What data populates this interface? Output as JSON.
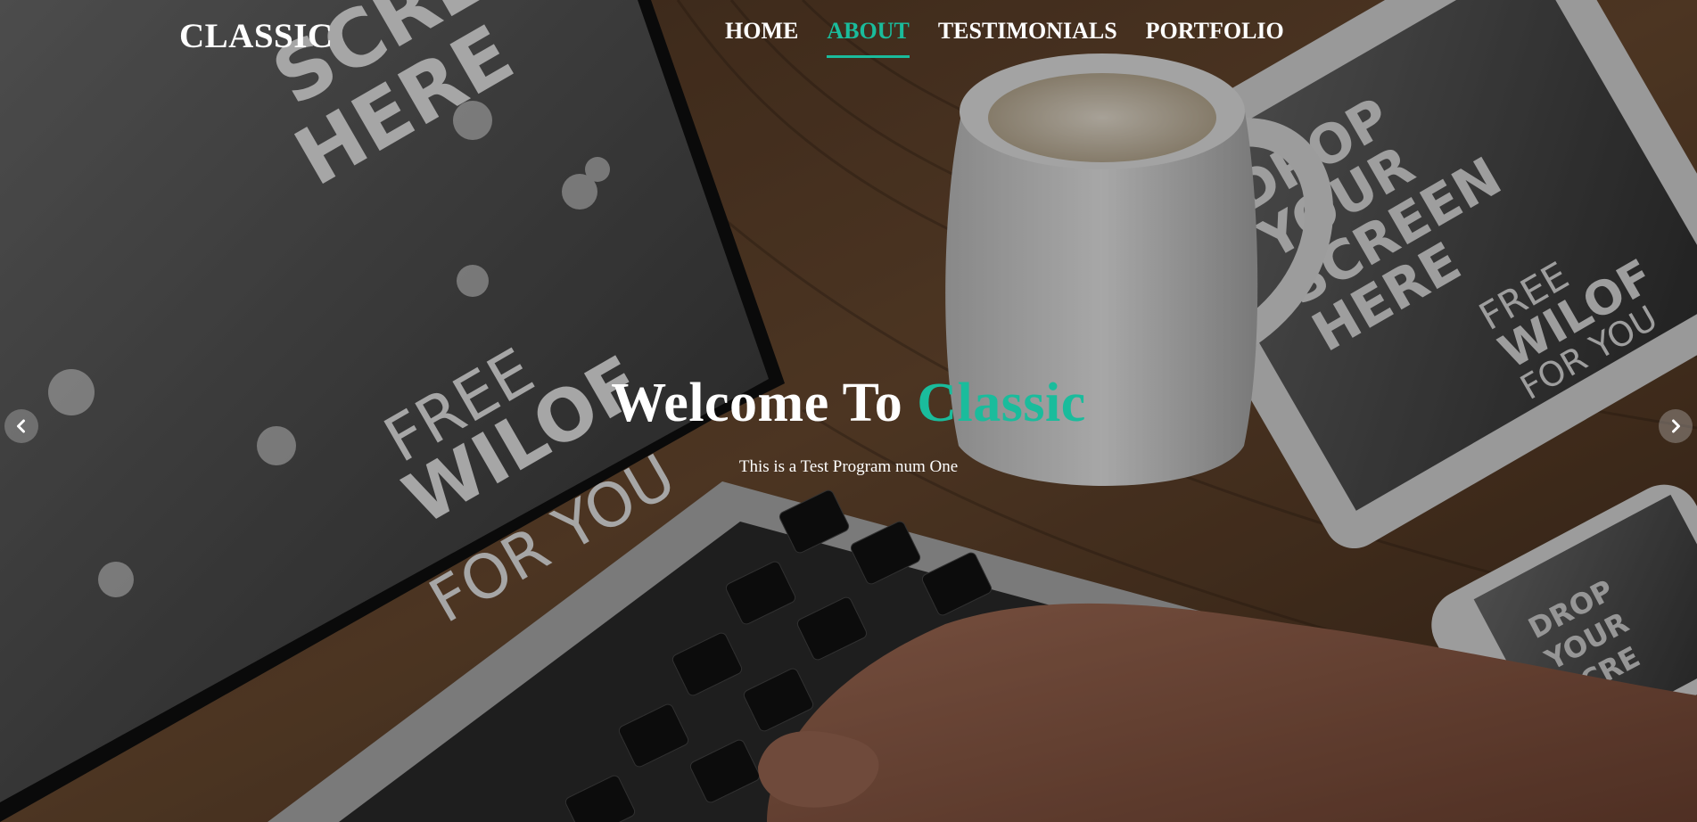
{
  "brand": {
    "name": "CLASSIC"
  },
  "nav": {
    "items": [
      {
        "label": "HOME",
        "active": false
      },
      {
        "label": "ABOUT",
        "active": true
      },
      {
        "label": "TESTIMONIALS",
        "active": false
      },
      {
        "label": "PORTFOLIO",
        "active": false
      }
    ]
  },
  "hero": {
    "title_prefix": "Welcome To",
    "title_accent": "Classic",
    "subtitle": "This is a Test Program num One",
    "background_screen_text": {
      "laptop_top": [
        "SCRE",
        "HERE"
      ],
      "laptop_main": [
        "FREE",
        "WILOF",
        "FOR YOU"
      ],
      "tablet": [
        "DROP",
        "YOUR",
        "SCREEN",
        "HERE",
        "FREE",
        "WILOF",
        "FOR YOU"
      ],
      "phone": [
        "DROP",
        "YOUR",
        "SCRE"
      ]
    }
  },
  "carousel": {
    "prev_icon": "chevron-left-icon",
    "next_icon": "chevron-right-icon"
  },
  "colors": {
    "accent": "#1abc9c",
    "text": "#ffffff"
  }
}
